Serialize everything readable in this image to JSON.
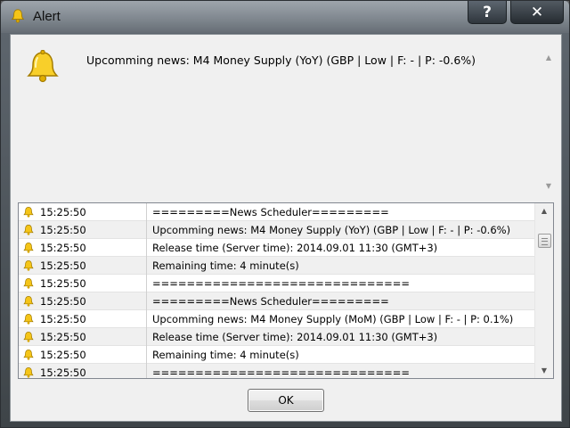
{
  "window": {
    "title": "Alert",
    "help_label": "?",
    "close_label": "✕"
  },
  "message": {
    "text": "Upcomming news: M4 Money Supply (YoY) (GBP | Low | F: - | P: -0.6%)"
  },
  "log": {
    "rows": [
      {
        "time": "15:25:50",
        "text": "=========News Scheduler========="
      },
      {
        "time": "15:25:50",
        "text": "Upcomming news: M4 Money Supply (YoY) (GBP | Low | F: - | P: -0.6%)"
      },
      {
        "time": "15:25:50",
        "text": "Release time (Server time): 2014.09.01 11:30 (GMT+3)"
      },
      {
        "time": "15:25:50",
        "text": "Remaining time: 4 minute(s)"
      },
      {
        "time": "15:25:50",
        "text": "=============================="
      },
      {
        "time": "15:25:50",
        "text": "=========News Scheduler========="
      },
      {
        "time": "15:25:50",
        "text": "Upcomming news: M4 Money Supply (MoM) (GBP | Low | F: - | P: 0.1%)"
      },
      {
        "time": "15:25:50",
        "text": "Release time (Server time): 2014.09.01 11:30 (GMT+3)"
      },
      {
        "time": "15:25:50",
        "text": "Remaining time: 4 minute(s)"
      },
      {
        "time": "15:25:50",
        "text": "=============================="
      }
    ]
  },
  "ok_button": {
    "label": "OK"
  },
  "icons": {
    "alert": "bell-icon"
  },
  "colors": {
    "bell": "#f5c518",
    "window_frame": "#5d656d"
  }
}
